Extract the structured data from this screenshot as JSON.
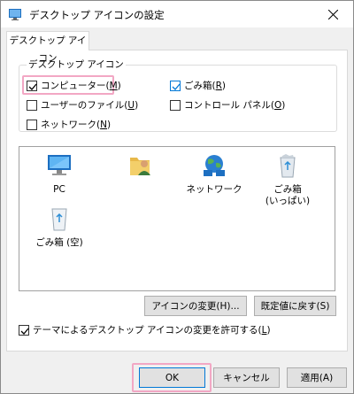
{
  "window": {
    "title": "デスクトップ アイコンの設定"
  },
  "tab": {
    "label": "デスクトップ アイコン"
  },
  "group": {
    "title": "デスクトップ アイコン",
    "checkboxes": [
      {
        "label": "コンピューター(",
        "key": "M",
        "suffix": ")",
        "checked": true
      },
      {
        "label": "ごみ箱(",
        "key": "R",
        "suffix": ")",
        "checked": true
      },
      {
        "label": "ユーザーのファイル(",
        "key": "U",
        "suffix": ")",
        "checked": false
      },
      {
        "label": "コントロール パネル(",
        "key": "O",
        "suffix": ")",
        "checked": false
      },
      {
        "label": "ネットワーク(",
        "key": "N",
        "suffix": ")",
        "checked": false
      }
    ]
  },
  "icons": [
    {
      "label": "PC",
      "icon": "pc-icon"
    },
    {
      "label": "",
      "icon": "user-files-icon"
    },
    {
      "label": "ネットワーク",
      "icon": "network-icon"
    },
    {
      "label": "ごみ箱",
      "label2": "(いっぱい)",
      "icon": "recycle-bin-full-icon"
    },
    {
      "label": "ごみ箱 (空)",
      "icon": "recycle-bin-empty-icon"
    }
  ],
  "buttons": {
    "change_icon": "アイコンの変更(H)...",
    "restore_default": "既定値に戻す(S)",
    "ok": "OK",
    "cancel": "キャンセル",
    "apply": "適用(A)"
  },
  "theme_checkbox": {
    "label": "テーマによるデスクトップ アイコンの変更を許可する(",
    "key": "L",
    "suffix": ")",
    "checked": true
  },
  "colors": {
    "highlight": "#f2a7c4",
    "accent": "#0078d7"
  }
}
